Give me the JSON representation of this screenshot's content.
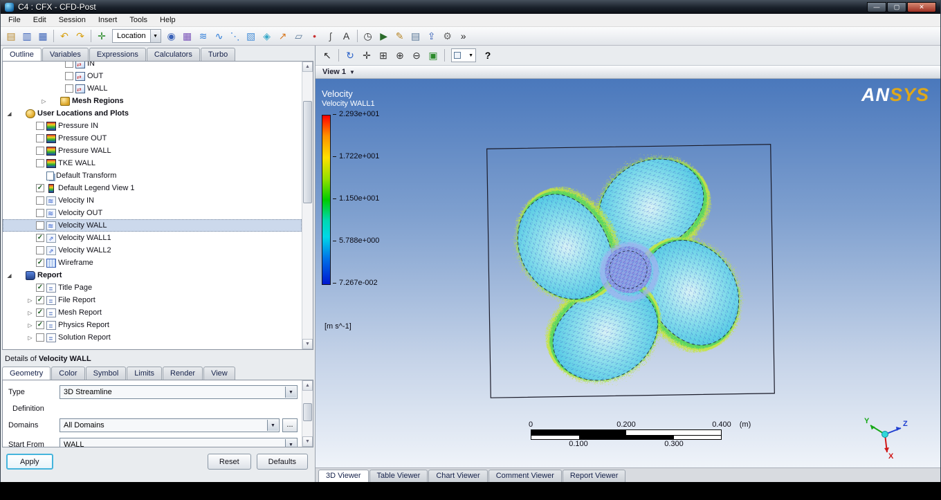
{
  "window": {
    "title": "C4 : CFX - CFD-Post",
    "buttons": {
      "minimize": "—",
      "maximize": "▢",
      "close": "✕"
    }
  },
  "menubar": {
    "items": [
      "File",
      "Edit",
      "Session",
      "Insert",
      "Tools",
      "Help"
    ]
  },
  "toolbar": {
    "location_label": "Location",
    "icons_a": [
      {
        "name": "load-results-icon",
        "glyph": "▤",
        "color": "#b8872a"
      },
      {
        "name": "save-state-icon",
        "glyph": "▥",
        "color": "#3a62b8"
      },
      {
        "name": "save-project-icon",
        "glyph": "▦",
        "color": "#3a62b8"
      },
      {
        "name": "sep"
      },
      {
        "name": "undo-icon",
        "glyph": "↶",
        "color": "#d8a010"
      },
      {
        "name": "redo-icon",
        "glyph": "↷",
        "color": "#d8a010"
      },
      {
        "name": "sep"
      },
      {
        "name": "probe-icon",
        "glyph": "✛",
        "color": "#2a8a2a"
      }
    ],
    "icons_b": [
      {
        "name": "vortex-region-icon",
        "glyph": "◉",
        "color": "#3a62b8"
      },
      {
        "name": "mesh-calculator-icon",
        "glyph": "▦",
        "color": "#7a52b8"
      },
      {
        "name": "contour-icon",
        "glyph": "≋",
        "color": "#2a7ad8"
      },
      {
        "name": "streamline-icon",
        "glyph": "∿",
        "color": "#2a7ad8"
      },
      {
        "name": "particle-track-icon",
        "glyph": "⋱",
        "color": "#2a7ad8"
      },
      {
        "name": "volume-rendering-icon",
        "glyph": "▧",
        "color": "#4a90d8"
      },
      {
        "name": "isosurface-icon",
        "glyph": "◈",
        "color": "#36a8c8"
      },
      {
        "name": "vector-icon",
        "glyph": "↗",
        "color": "#d87820"
      },
      {
        "name": "plane-icon",
        "glyph": "▱",
        "color": "#5a7898"
      },
      {
        "name": "point-icon",
        "glyph": "•",
        "color": "#c83030"
      },
      {
        "name": "polyline-icon",
        "glyph": "ʃ",
        "color": "#555"
      },
      {
        "name": "text-label-icon",
        "glyph": "A",
        "color": "#333"
      },
      {
        "name": "sep"
      },
      {
        "name": "timestep-selector-icon",
        "glyph": "◷",
        "color": "#333"
      },
      {
        "name": "animation-icon",
        "glyph": "▶",
        "color": "#2a6a2a"
      },
      {
        "name": "quick-editor-icon",
        "glyph": "✎",
        "color": "#b8872a"
      },
      {
        "name": "report-template-icon",
        "glyph": "▤",
        "color": "#5a7898"
      },
      {
        "name": "report-publish-icon",
        "glyph": "⇪",
        "color": "#3a62b8"
      },
      {
        "name": "macro-calculator-icon",
        "glyph": "⚙",
        "color": "#666"
      },
      {
        "name": "command-editor-icon",
        "glyph": "»",
        "color": "#222"
      }
    ]
  },
  "left_tabs": [
    {
      "label": "Outline",
      "active": true
    },
    {
      "label": "Variables"
    },
    {
      "label": "Expressions"
    },
    {
      "label": "Calculators"
    },
    {
      "label": "Turbo"
    }
  ],
  "tree": {
    "items": [
      {
        "label": "IN",
        "level": 4,
        "checkbox": "unchecked",
        "icon": "boundary-icon"
      },
      {
        "label": "OUT",
        "level": 4,
        "checkbox": "unchecked",
        "icon": "boundary-icon"
      },
      {
        "label": "WALL",
        "level": 4,
        "checkbox": "unchecked",
        "icon": "boundary-icon"
      },
      {
        "label": "Mesh Regions",
        "level": 3,
        "arrow": "collapsed",
        "checkbox": "none",
        "icon": "mesh-regions-icon",
        "bold": true
      },
      {
        "label": "User Locations and Plots",
        "level": 1,
        "arrow": "expanded",
        "checkbox": "none",
        "icon": "locations-icon",
        "bold": true
      },
      {
        "label": "Pressure IN",
        "level": 2,
        "checkbox": "unchecked",
        "icon": "contour-icon"
      },
      {
        "label": "Pressure OUT",
        "level": 2,
        "checkbox": "unchecked",
        "icon": "contour-icon"
      },
      {
        "label": "Pressure WALL",
        "level": 2,
        "checkbox": "unchecked",
        "icon": "contour-icon"
      },
      {
        "label": "TKE WALL",
        "level": 2,
        "checkbox": "unchecked",
        "icon": "contour-icon"
      },
      {
        "label": "Default Transform",
        "level": 2,
        "checkbox": "none",
        "icon": "transform-icon"
      },
      {
        "label": "Default Legend View 1",
        "level": 2,
        "checkbox": "checked",
        "icon": "legend-icon"
      },
      {
        "label": "Velocity IN",
        "level": 2,
        "checkbox": "unchecked",
        "icon": "streamline-icon"
      },
      {
        "label": "Velocity OUT",
        "level": 2,
        "checkbox": "unchecked",
        "icon": "streamline-icon"
      },
      {
        "label": "Velocity WALL",
        "level": 2,
        "checkbox": "unchecked",
        "icon": "streamline-icon",
        "selected": true
      },
      {
        "label": "Velocity WALL1",
        "level": 2,
        "checkbox": "checked",
        "icon": "vector-icon"
      },
      {
        "label": "Velocity WALL2",
        "level": 2,
        "checkbox": "unchecked",
        "icon": "vector-icon"
      },
      {
        "label": "Wireframe",
        "level": 2,
        "checkbox": "checked",
        "icon": "wireframe-icon"
      },
      {
        "label": "Report",
        "level": 1,
        "arrow": "expanded",
        "checkbox": "none",
        "icon": "report-icon",
        "bold": true
      },
      {
        "label": "Title Page",
        "level": 2,
        "checkbox": "checked",
        "icon": "report-page-icon"
      },
      {
        "label": "File Report",
        "level": 2,
        "arrow": "collapsed",
        "checkbox": "checked",
        "icon": "report-page-icon"
      },
      {
        "label": "Mesh Report",
        "level": 2,
        "arrow": "collapsed",
        "checkbox": "checked",
        "icon": "report-page-icon"
      },
      {
        "label": "Physics Report",
        "level": 2,
        "arrow": "collapsed",
        "checkbox": "checked",
        "icon": "report-page-icon"
      },
      {
        "label": "Solution Report",
        "level": 2,
        "arrow": "collapsed",
        "checkbox": "unchecked",
        "icon": "report-page-icon"
      }
    ]
  },
  "details": {
    "prefix": "Details of ",
    "object": "Velocity WALL",
    "tabs": [
      {
        "label": "Geometry",
        "active": true
      },
      {
        "label": "Color"
      },
      {
        "label": "Symbol"
      },
      {
        "label": "Limits"
      },
      {
        "label": "Render"
      },
      {
        "label": "View"
      }
    ],
    "type_label": "Type",
    "type_value": "3D Streamline",
    "definition_label": "Definition",
    "domains_label": "Domains",
    "domains_value": "All Domains",
    "domains_more": "...",
    "start_from_label": "Start From",
    "start_from_value": "WALL",
    "apply": "Apply",
    "reset": "Reset",
    "defaults": "Defaults"
  },
  "viewer": {
    "toolbar_icons": [
      {
        "name": "select-tool-icon",
        "glyph": "↖",
        "color": "#222"
      },
      {
        "name": "sep"
      },
      {
        "name": "rotate-tool-icon",
        "glyph": "↻",
        "color": "#2a62c8"
      },
      {
        "name": "pan-tool-icon",
        "glyph": "✛",
        "color": "#333"
      },
      {
        "name": "zoom-box-tool-icon",
        "glyph": "⊞",
        "color": "#333"
      },
      {
        "name": "zoom-in-tool-icon",
        "glyph": "⊕",
        "color": "#333"
      },
      {
        "name": "zoom-out-tool-icon",
        "glyph": "⊖",
        "color": "#333"
      },
      {
        "name": "fit-view-icon",
        "glyph": "▣",
        "color": "#2a8a2a"
      },
      {
        "name": "sep"
      }
    ],
    "help_label": "?",
    "view_label": "View 1",
    "legend": {
      "title": "Velocity",
      "subtitle": "Velocity WALL1",
      "ticks": [
        "2.293e+001",
        "1.722e+001",
        "1.150e+001",
        "5.788e+000",
        "7.267e-002"
      ],
      "units": "[m s^-1]"
    },
    "logo": {
      "part1": "AN",
      "part2": "SYS"
    },
    "ruler": {
      "top": [
        "0",
        "0.200",
        "0.400"
      ],
      "unit": "(m)",
      "bottom": [
        "0.100",
        "0.300"
      ]
    },
    "triad": {
      "x": "X",
      "y": "Y",
      "z": "Z"
    },
    "tabs": [
      {
        "label": "3D Viewer",
        "active": true
      },
      {
        "label": "Table Viewer"
      },
      {
        "label": "Chart Viewer"
      },
      {
        "label": "Comment Viewer"
      },
      {
        "label": "Report Viewer"
      }
    ]
  },
  "colors": {
    "viewport_top": "#4a78bc",
    "viewport_bottom": "#eff3f9",
    "ansys_gold": "#e0a818",
    "legend_top": "#ff0000",
    "legend_bottom": "#0018d0",
    "blade_body": "#46c6e2",
    "blade_fringe": "#c6e63c"
  }
}
